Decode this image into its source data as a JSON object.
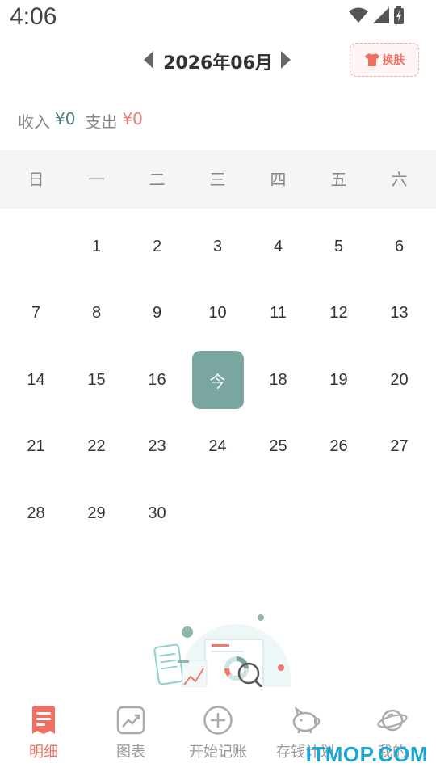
{
  "status_bar": {
    "time": "4:06"
  },
  "header": {
    "title": "2026年06月",
    "skin_button": "换肤"
  },
  "summary": {
    "income_label": "收入",
    "income_value": "¥0",
    "expense_label": "支出",
    "expense_value": "¥0"
  },
  "weekdays": [
    "日",
    "一",
    "二",
    "三",
    "四",
    "五",
    "六"
  ],
  "calendar": {
    "today_label": "今",
    "weeks": [
      [
        "",
        "1",
        "2",
        "3",
        "4",
        "5",
        "6"
      ],
      [
        "7",
        "8",
        "9",
        "10",
        "11",
        "12",
        "13"
      ],
      [
        "14",
        "15",
        "16",
        "今",
        "18",
        "19",
        "20"
      ],
      [
        "21",
        "22",
        "23",
        "24",
        "25",
        "26",
        "27"
      ],
      [
        "28",
        "29",
        "30",
        "",
        "",
        "",
        ""
      ]
    ]
  },
  "nav": {
    "items": [
      {
        "label": "明细",
        "icon": "list-note-icon",
        "active": true
      },
      {
        "label": "图表",
        "icon": "chart-icon",
        "active": false
      },
      {
        "label": "开始记账",
        "icon": "plus-circle-icon",
        "active": false
      },
      {
        "label": "存钱计划",
        "icon": "piggy-bank-icon",
        "active": false
      },
      {
        "label": "我的",
        "icon": "planet-icon",
        "active": false
      }
    ]
  },
  "watermark": "ITMOP.COM",
  "colors": {
    "accent": "#ef6f63",
    "today": "#79a6a1",
    "income": "#4a7b7e",
    "expense": "#ef7a6d"
  }
}
